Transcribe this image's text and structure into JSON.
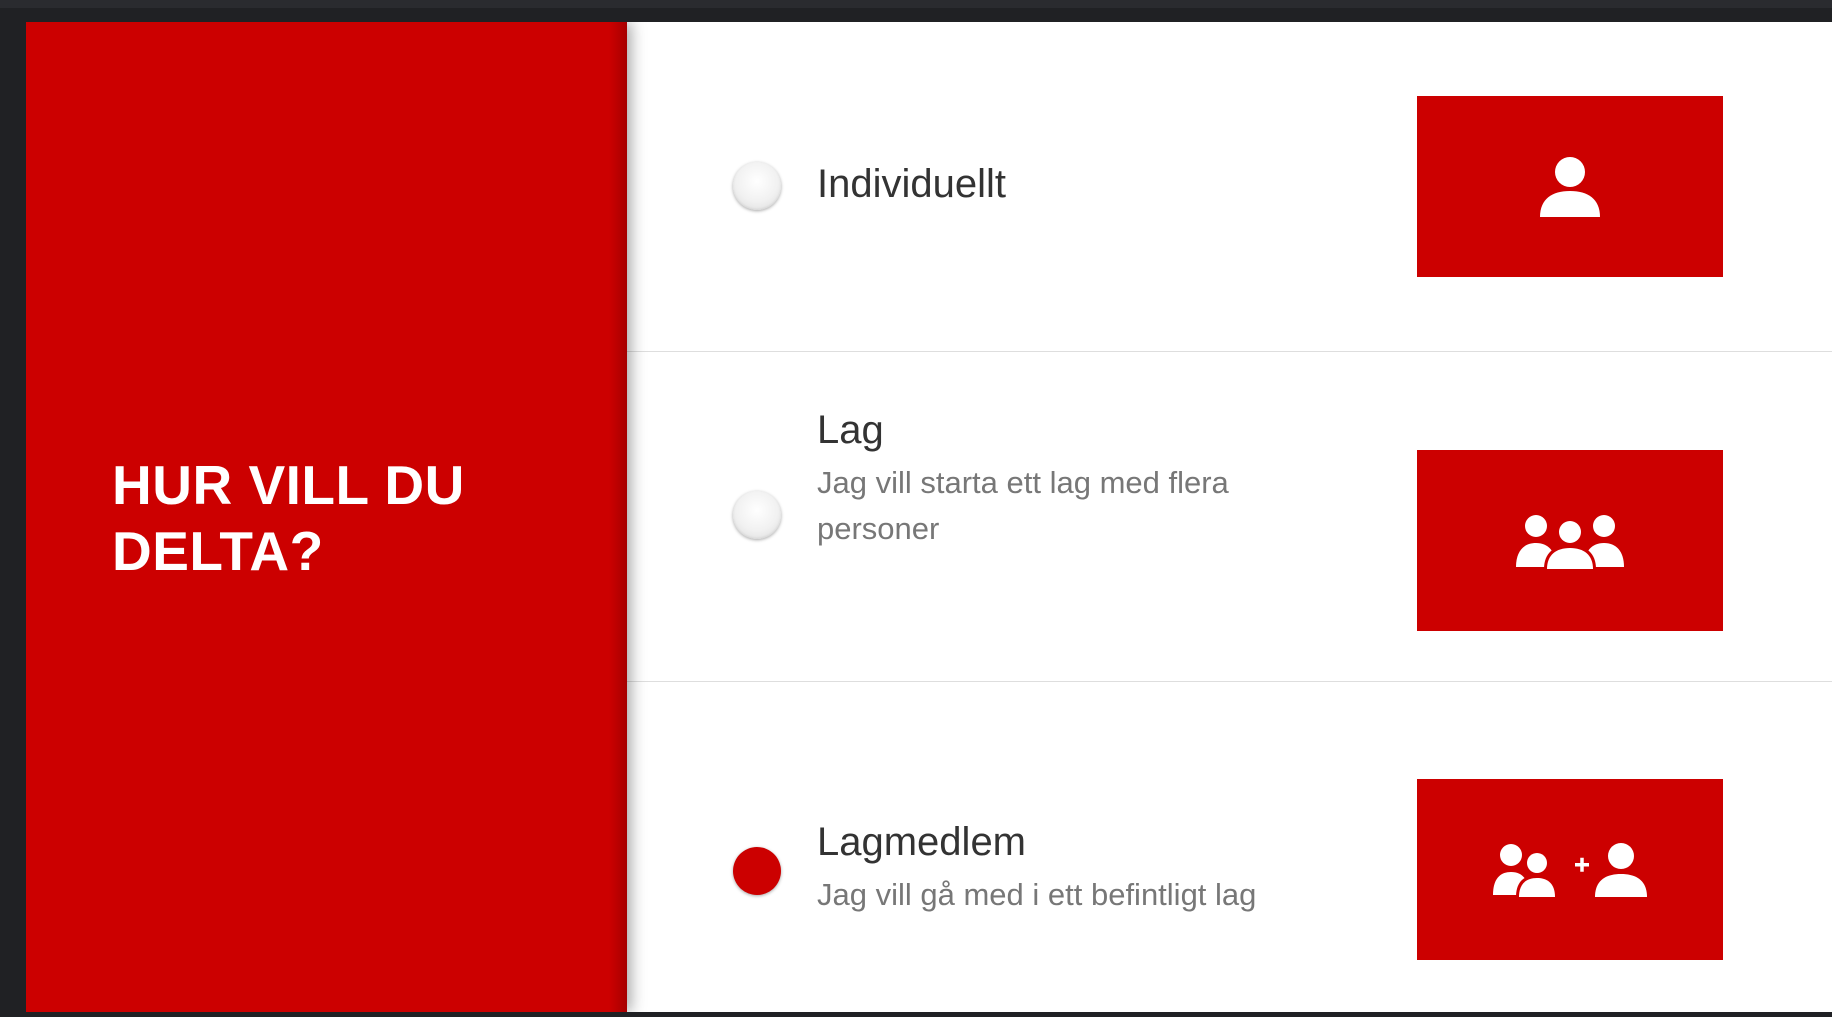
{
  "panel": {
    "title": "HUR VILL DU\nDELTA?",
    "background_color": "#cc0000"
  },
  "options": [
    {
      "title": "Individuellt",
      "description": "",
      "selected": false,
      "icon": "single-user-icon"
    },
    {
      "title": "Lag",
      "description": "Jag vill starta ett lag med flera personer",
      "selected": false,
      "icon": "team-group-icon"
    },
    {
      "title": "Lagmedlem",
      "description": "Jag vill gå med i ett befintligt lag",
      "selected": true,
      "icon": "join-team-icon"
    }
  ],
  "colors": {
    "accent": "#cc0000",
    "title_text": "#333333",
    "description_text": "#777777",
    "divider": "#dedede"
  }
}
